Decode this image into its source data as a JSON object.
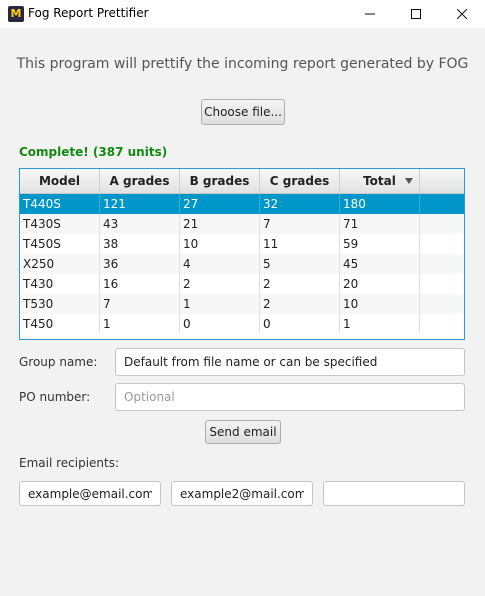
{
  "window": {
    "title": "Fog Report Prettifier",
    "icon_letter": "M"
  },
  "intro_text": "This program will prettify the incoming report generated by FOG",
  "choose_file_label": "Choose file...",
  "status_text": "Complete! (387 units)",
  "table": {
    "columns": [
      "Model",
      "A grades",
      "B grades",
      "C grades",
      "Total"
    ],
    "sorted_column": "Total",
    "rows": [
      [
        "T440S",
        "121",
        "27",
        "32",
        "180"
      ],
      [
        "T430S",
        "43",
        "21",
        "7",
        "71"
      ],
      [
        "T450S",
        "38",
        "10",
        "11",
        "59"
      ],
      [
        "X250",
        "36",
        "4",
        "5",
        "45"
      ],
      [
        "T430",
        "16",
        "2",
        "2",
        "20"
      ],
      [
        "T530",
        "7",
        "1",
        "2",
        "10"
      ],
      [
        "T450",
        "1",
        "0",
        "0",
        "1"
      ]
    ],
    "selected_row": 0
  },
  "group_name": {
    "label": "Group name:",
    "value": "Default from file name or can be specified"
  },
  "po_number": {
    "label": "PO number:",
    "placeholder": "Optional",
    "value": ""
  },
  "send_email_label": "Send email",
  "email_recipients": {
    "label": "Email recipients:",
    "values": [
      "example@email.com",
      "example2@mail.com",
      ""
    ]
  },
  "colors": {
    "accent": "#0096c9",
    "status_green": "#148a14",
    "table_border": "#2a9bd4"
  }
}
